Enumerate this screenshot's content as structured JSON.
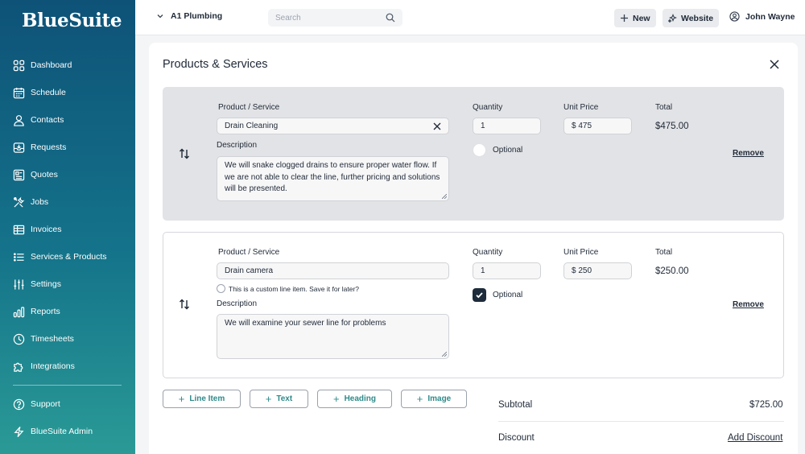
{
  "sidebar": {
    "brand": "BlueSuite",
    "items": [
      {
        "label": "Dashboard",
        "icon": "dashboard-icon"
      },
      {
        "label": "Schedule",
        "icon": "calendar-icon"
      },
      {
        "label": "Contacts",
        "icon": "person-icon"
      },
      {
        "label": "Requests",
        "icon": "inbox-icon"
      },
      {
        "label": "Quotes",
        "icon": "document-icon"
      },
      {
        "label": "Jobs",
        "icon": "tools-icon"
      },
      {
        "label": "Invoices",
        "icon": "invoice-icon"
      },
      {
        "label": "Services & Products",
        "icon": "list-icon"
      },
      {
        "label": "Settings",
        "icon": "sliders-icon"
      },
      {
        "label": "Reports",
        "icon": "bar-chart-icon"
      },
      {
        "label": "Timesheets",
        "icon": "clock-icon"
      },
      {
        "label": "Integrations",
        "icon": "puzzle-icon"
      }
    ],
    "bottom_items": [
      {
        "label": "Support",
        "icon": "help-icon"
      },
      {
        "label": "BlueSuite Admin",
        "icon": "lightning-icon"
      }
    ]
  },
  "header": {
    "company": "A1 Plumbing",
    "search_placeholder": "Search",
    "new_label": "New",
    "website_label": "Website",
    "user_name": "John Wayne"
  },
  "modal": {
    "title": "Products & Services",
    "labels": {
      "product": "Product / Service",
      "quantity": "Quantity",
      "unit_price": "Unit Price",
      "total": "Total",
      "description": "Description",
      "optional": "Optional",
      "remove": "Remove"
    },
    "line_items": [
      {
        "product": "Drain Cleaning",
        "quantity": "1",
        "unit_price": "$ 475",
        "total": "$475.00",
        "description": "We  will snake clogged drains to ensure proper water flow. If we are not able to clear the line, further pricing and solutions will be presented.",
        "optional": false
      },
      {
        "product": "Drain camera",
        "quantity": "1",
        "unit_price": "$ 250",
        "total": "$250.00",
        "custom_hint": "This is a custom line item. Save it for later?",
        "description": "We will examine your sewer line for problems",
        "optional": true
      }
    ],
    "add_buttons": [
      "Line Item",
      "Text",
      "Heading",
      "Image"
    ],
    "summary": {
      "subtotal_label": "Subtotal",
      "subtotal_value": "$725.00",
      "discount_label": "Discount",
      "discount_action": "Add Discount"
    }
  },
  "colors": {
    "sidebar_top": "#0e5278",
    "sidebar_bottom": "#2a9a96",
    "accent_teal": "#2f8a8a",
    "checkbox_checked": "#1d2b3a"
  }
}
